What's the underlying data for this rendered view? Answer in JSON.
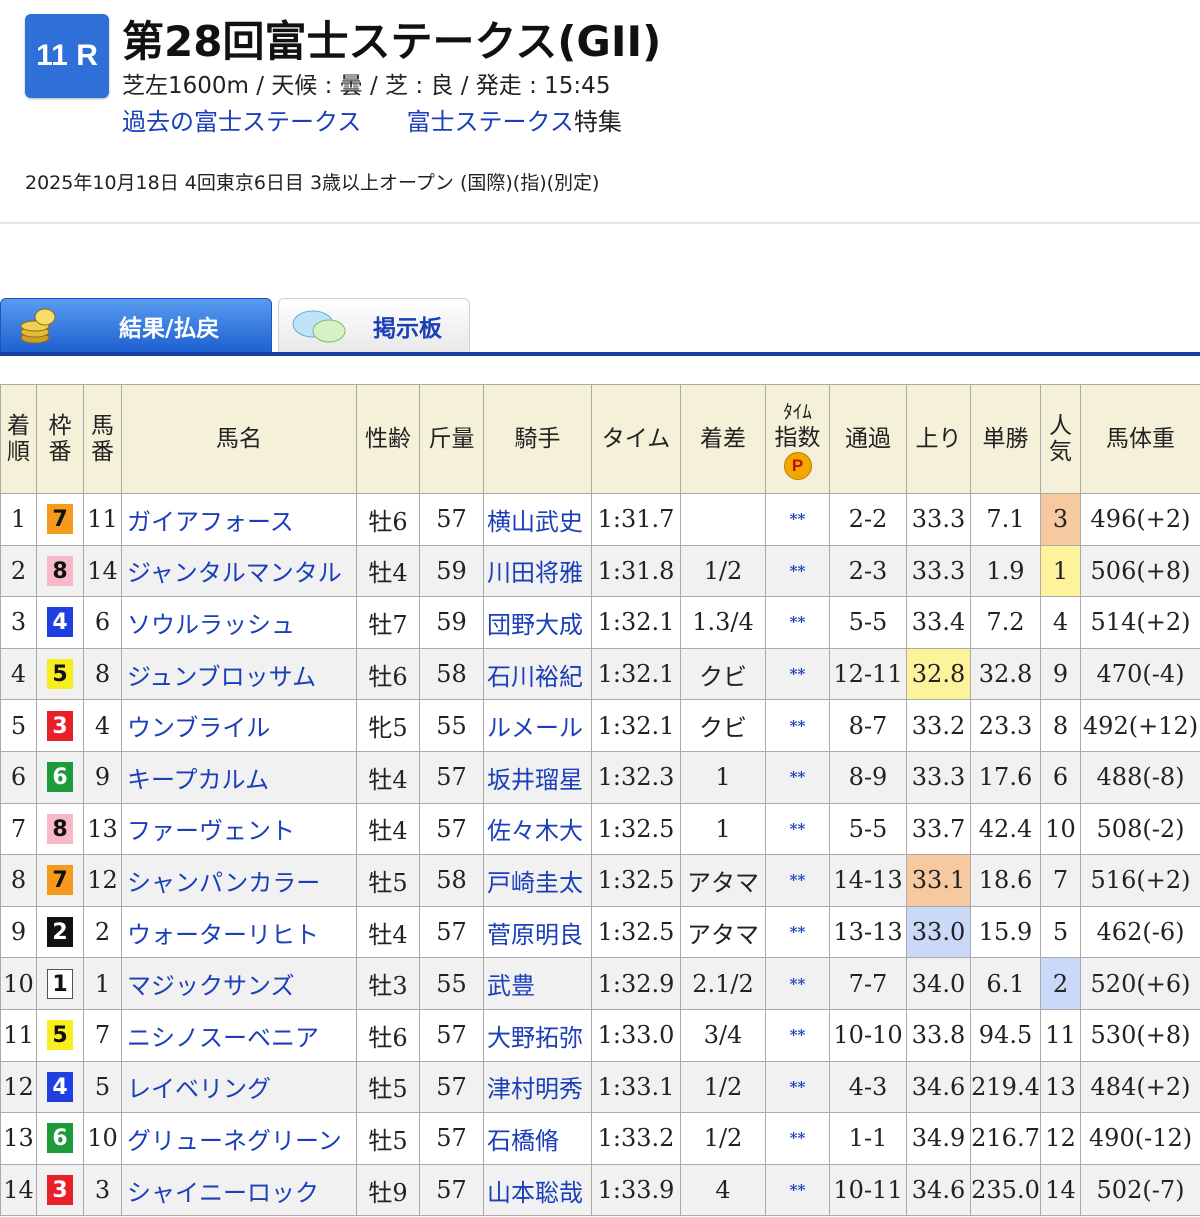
{
  "race": {
    "badge": "11 R",
    "title": "第28回富士ステークス(GII)",
    "info": "芝左1600m /  天候 : 曇 /  芝 : 良  /  発走 : 15:45",
    "link_past": "過去の富士ステークス",
    "link_feature": "富士ステークス",
    "feature_suffix": "特集",
    "date_line": "2025年10月18日 4回東京6日目 3歳以上オープン  (国際)(指)(別定)"
  },
  "tabs": {
    "result": "結果/払戻",
    "board": "掲示板"
  },
  "table": {
    "headers": {
      "rank": [
        "着",
        "順"
      ],
      "waku": [
        "枠",
        "番"
      ],
      "umaban": [
        "馬",
        "番"
      ],
      "name": "馬名",
      "sexage": "性齢",
      "weight": "斤量",
      "jockey": "騎手",
      "time": "タイム",
      "margin": "着差",
      "index_top": "ﾀｲﾑ",
      "index_bottom": "指数",
      "index_icon": "P",
      "passing": "通過",
      "last3f": "上り",
      "odds": "単勝",
      "pop": [
        "人",
        "気"
      ],
      "bodyweight": "馬体重"
    },
    "rows": [
      {
        "rank": "1",
        "waku": "7",
        "umaban": "11",
        "name": "ガイアフォース",
        "sexage": "牡6",
        "weight": "57",
        "jockey": "横山武史",
        "time": "1:31.7",
        "margin": "",
        "index": "**",
        "passing": "2-2",
        "last3f": "33.3",
        "odds": "7.1",
        "pop": "3",
        "bodyweight": "496(+2)"
      },
      {
        "rank": "2",
        "waku": "8",
        "umaban": "14",
        "name": "ジャンタルマンタル",
        "sexage": "牡4",
        "weight": "59",
        "jockey": "川田将雅",
        "time": "1:31.8",
        "margin": "1/2",
        "index": "**",
        "passing": "2-3",
        "last3f": "33.3",
        "odds": "1.9",
        "pop": "1",
        "bodyweight": "506(+8)"
      },
      {
        "rank": "3",
        "waku": "4",
        "umaban": "6",
        "name": "ソウルラッシュ",
        "sexage": "牡7",
        "weight": "59",
        "jockey": "団野大成",
        "time": "1:32.1",
        "margin": "1.3/4",
        "index": "**",
        "passing": "5-5",
        "last3f": "33.4",
        "odds": "7.2",
        "pop": "4",
        "bodyweight": "514(+2)"
      },
      {
        "rank": "4",
        "waku": "5",
        "umaban": "8",
        "name": "ジュンブロッサム",
        "sexage": "牡6",
        "weight": "58",
        "jockey": "石川裕紀",
        "time": "1:32.1",
        "margin": "クビ",
        "index": "**",
        "passing": "12-11",
        "last3f": "32.8",
        "odds": "32.8",
        "pop": "9",
        "bodyweight": "470(-4)"
      },
      {
        "rank": "5",
        "waku": "3",
        "umaban": "4",
        "name": "ウンブライル",
        "sexage": "牝5",
        "weight": "55",
        "jockey": "ルメール",
        "time": "1:32.1",
        "margin": "クビ",
        "index": "**",
        "passing": "8-7",
        "last3f": "33.2",
        "odds": "23.3",
        "pop": "8",
        "bodyweight": "492(+12)"
      },
      {
        "rank": "6",
        "waku": "6",
        "umaban": "9",
        "name": "キープカルム",
        "sexage": "牡4",
        "weight": "57",
        "jockey": "坂井瑠星",
        "time": "1:32.3",
        "margin": "1",
        "index": "**",
        "passing": "8-9",
        "last3f": "33.3",
        "odds": "17.6",
        "pop": "6",
        "bodyweight": "488(-8)"
      },
      {
        "rank": "7",
        "waku": "8",
        "umaban": "13",
        "name": "ファーヴェント",
        "sexage": "牡4",
        "weight": "57",
        "jockey": "佐々木大",
        "time": "1:32.5",
        "margin": "1",
        "index": "**",
        "passing": "5-5",
        "last3f": "33.7",
        "odds": "42.4",
        "pop": "10",
        "bodyweight": "508(-2)"
      },
      {
        "rank": "8",
        "waku": "7",
        "umaban": "12",
        "name": "シャンパンカラー",
        "sexage": "牡5",
        "weight": "58",
        "jockey": "戸崎圭太",
        "time": "1:32.5",
        "margin": "アタマ",
        "index": "**",
        "passing": "14-13",
        "last3f": "33.1",
        "odds": "18.6",
        "pop": "7",
        "bodyweight": "516(+2)"
      },
      {
        "rank": "9",
        "waku": "2",
        "umaban": "2",
        "name": "ウォーターリヒト",
        "sexage": "牡4",
        "weight": "57",
        "jockey": "菅原明良",
        "time": "1:32.5",
        "margin": "アタマ",
        "index": "**",
        "passing": "13-13",
        "last3f": "33.0",
        "odds": "15.9",
        "pop": "5",
        "bodyweight": "462(-6)"
      },
      {
        "rank": "10",
        "waku": "1",
        "umaban": "1",
        "name": "マジックサンズ",
        "sexage": "牡3",
        "weight": "55",
        "jockey": "武豊",
        "time": "1:32.9",
        "margin": "2.1/2",
        "index": "**",
        "passing": "7-7",
        "last3f": "34.0",
        "odds": "6.1",
        "pop": "2",
        "bodyweight": "520(+6)"
      },
      {
        "rank": "11",
        "waku": "5",
        "umaban": "7",
        "name": "ニシノスーベニア",
        "sexage": "牡6",
        "weight": "57",
        "jockey": "大野拓弥",
        "time": "1:33.0",
        "margin": "3/4",
        "index": "**",
        "passing": "10-10",
        "last3f": "33.8",
        "odds": "94.5",
        "pop": "11",
        "bodyweight": "530(+8)"
      },
      {
        "rank": "12",
        "waku": "4",
        "umaban": "5",
        "name": "レイベリング",
        "sexage": "牡5",
        "weight": "57",
        "jockey": "津村明秀",
        "time": "1:33.1",
        "margin": "1/2",
        "index": "**",
        "passing": "4-3",
        "last3f": "34.6",
        "odds": "219.4",
        "pop": "13",
        "bodyweight": "484(+2)"
      },
      {
        "rank": "13",
        "waku": "6",
        "umaban": "10",
        "name": "グリューネグリーン",
        "sexage": "牡5",
        "weight": "57",
        "jockey": "石橋脩",
        "time": "1:33.2",
        "margin": "1/2",
        "index": "**",
        "passing": "1-1",
        "last3f": "34.9",
        "odds": "216.7",
        "pop": "12",
        "bodyweight": "490(-12)"
      },
      {
        "rank": "14",
        "waku": "3",
        "umaban": "3",
        "name": "シャイニーロック",
        "sexage": "牡9",
        "weight": "57",
        "jockey": "山本聡哉",
        "time": "1:33.9",
        "margin": "4",
        "index": "**",
        "passing": "10-11",
        "last3f": "34.6",
        "odds": "235.0",
        "pop": "14",
        "bodyweight": "502(-7)"
      }
    ]
  },
  "colors": {
    "waku": {
      "1": {
        "bg": "#ffffff",
        "fg": "#111111",
        "border": "#555555"
      },
      "2": {
        "bg": "#111111",
        "fg": "#ffffff",
        "border": "#111111"
      },
      "3": {
        "bg": "#e8202a",
        "fg": "#ffffff",
        "border": "#e8202a"
      },
      "4": {
        "bg": "#1f3fe0",
        "fg": "#ffffff",
        "border": "#1f3fe0"
      },
      "5": {
        "bg": "#f7ee1f",
        "fg": "#111111",
        "border": "#f7ee1f"
      },
      "6": {
        "bg": "#1d9a3a",
        "fg": "#ffffff",
        "border": "#1d9a3a"
      },
      "7": {
        "bg": "#f59a1d",
        "fg": "#111111",
        "border": "#f59a1d"
      },
      "8": {
        "bg": "#f7b9c8",
        "fg": "#111111",
        "border": "#f7b9c8"
      }
    },
    "link": "#1a3fb8",
    "header_bg": "#f5f0d8",
    "badge_bg": "#2f6fd8",
    "tab_line": "#163f9e"
  },
  "highlights": {
    "pop_orange_row": 0,
    "pop_yellow_row": 1,
    "pop_blue_row": 9,
    "last3f_yellow_row": 3,
    "last3f_orange_row": 7,
    "last3f_blue_row": 8
  }
}
